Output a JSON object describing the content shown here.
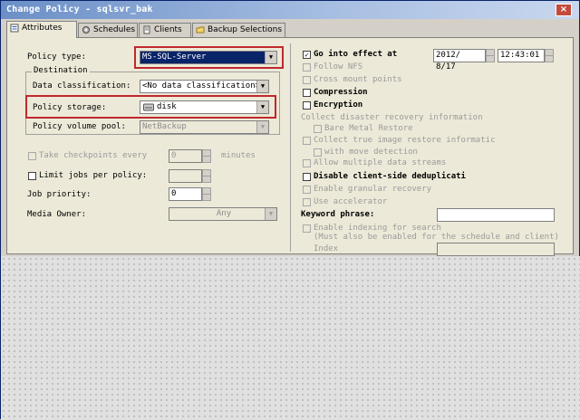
{
  "window": {
    "title": "Change Policy - sqlsvr_bak",
    "close_glyph": "×"
  },
  "tabs": [
    {
      "label": "Attributes",
      "icon": "attributes-icon"
    },
    {
      "label": "Schedules",
      "icon": "gear-icon"
    },
    {
      "label": "Clients",
      "icon": "document-icon"
    },
    {
      "label": "Backup Selections",
      "icon": "folder-icon"
    }
  ],
  "left": {
    "policy_type": {
      "label": "Policy type:",
      "value": "MS-SQL-Server"
    },
    "destination": {
      "title": "Destination",
      "data_classification": {
        "label": "Data classification:",
        "value": "<No data classification>"
      },
      "policy_storage": {
        "label": "Policy storage:",
        "value": "disk"
      },
      "policy_volume_pool": {
        "label": "Policy volume pool:",
        "value": "NetBackup"
      }
    },
    "take_checkpoints": {
      "label": "Take checkpoints every",
      "value": "0",
      "unit": "minutes"
    },
    "limit_jobs": {
      "label": "Limit jobs per policy:",
      "value": ""
    },
    "job_priority": {
      "label": "Job priority:",
      "value": "0"
    },
    "media_owner": {
      "label": "Media Owner:",
      "value": "Any"
    }
  },
  "right": {
    "go_into_effect": {
      "label": "Go into effect at",
      "date": "2012/ 8/17",
      "time": "12:43:01"
    },
    "follow_nfs": "Follow NFS",
    "cross_mount": "Cross mount points",
    "compression": "Compression",
    "encryption": "Encryption",
    "collect_dr": "Collect disaster recovery information",
    "bmr": "Bare Metal Restore",
    "collect_tir": "Collect true image restore informatic",
    "move_detection": "with move detection",
    "multiple_streams": "Allow multiple data streams",
    "disable_dedup": "Disable client-side deduplicati",
    "granular": "Enable granular recovery",
    "accelerator": "Use accelerator",
    "keyword": {
      "label": "Keyword phrase:",
      "value": ""
    },
    "indexing": "Enable indexing for search",
    "indexing_note": "(Must also be enabled for the schedule and client)",
    "index_server_label": "Index"
  },
  "colors": {
    "title_start": "#6b8fc7",
    "title_end": "#c9d7ee",
    "highlight": "#0a246a",
    "annotation_red": "#c0282d"
  }
}
